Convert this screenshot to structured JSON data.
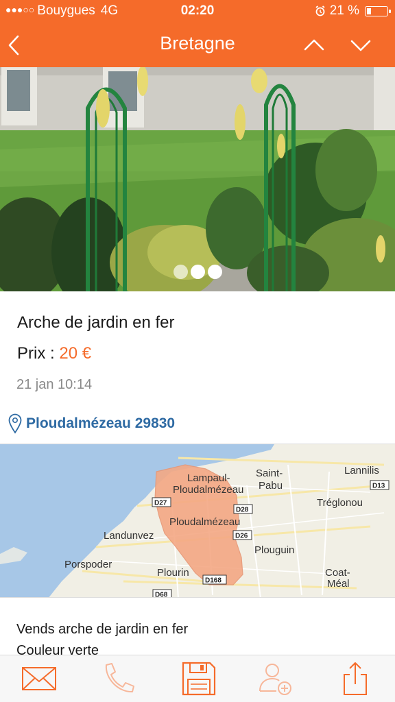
{
  "status": {
    "carrier": "Bouygues",
    "network": "4G",
    "time": "02:20",
    "battery": "21 %",
    "battery_level": 0.21
  },
  "header": {
    "title": "Bretagne"
  },
  "gallery": {
    "page_count": 3,
    "active_index": 2
  },
  "listing": {
    "title": "Arche de jardin en fer",
    "price_label": "Prix :",
    "price_value": "20 €",
    "date": "21 jan 10:14",
    "location": "Ploudalmézeau 29830",
    "description_lines": [
      "Vends arche de jardin en fer",
      "Couleur verte"
    ]
  },
  "map": {
    "places": [
      "Lampaul-",
      "Ploudalmézeau",
      "Saint-",
      "Pabu",
      "Lannilis",
      "Tréglonou",
      "Ploudalmézeau",
      "Landunvez",
      "Plouguin",
      "Porspoder",
      "Plourin",
      "Coat-",
      "Méal"
    ],
    "roads": [
      "D27",
      "D28",
      "D26",
      "D13",
      "D168",
      "D68"
    ]
  },
  "colors": {
    "accent": "#f56b2a",
    "link": "#2e6aa3"
  },
  "toolbar": {
    "icons": [
      "envelope-icon",
      "phone-icon",
      "save-icon",
      "add-contact-icon",
      "share-icon"
    ]
  }
}
